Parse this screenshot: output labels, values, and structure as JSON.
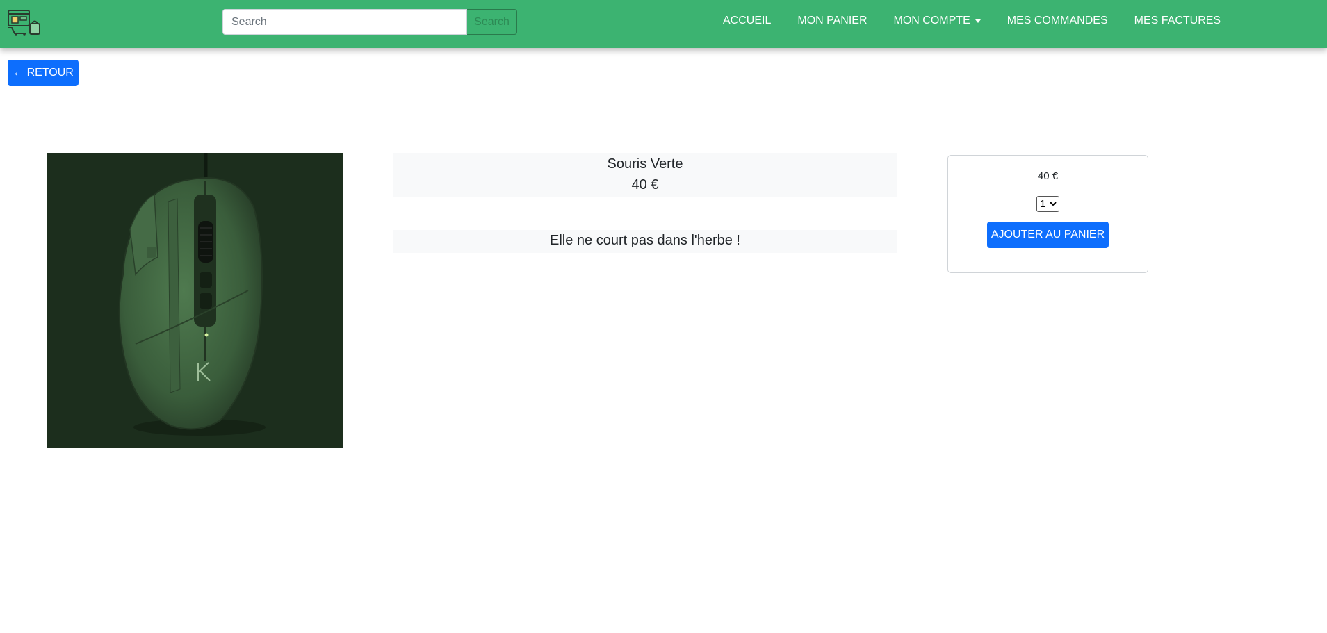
{
  "header": {
    "logo_icon": "shop-logo-icon",
    "search": {
      "placeholder": "Search",
      "value": "",
      "button_label": "Search"
    },
    "nav": [
      {
        "label": "ACCUEIL"
      },
      {
        "label": "MON PANIER"
      },
      {
        "label": "MON COMPTE"
      },
      {
        "label": "MES COMMANDES"
      },
      {
        "label": "MES FACTURES"
      }
    ]
  },
  "back_button": {
    "label": "← RETOUR"
  },
  "product": {
    "image_icon": "green-gaming-mouse",
    "name": "Souris Verte",
    "price": "40 €",
    "description": "Elle ne court pas dans l'herbe !"
  },
  "buy_card": {
    "price": "40 €",
    "quantity": "1",
    "add_label": "AJOUTER AU PANIER"
  },
  "colors": {
    "navbar": "#3cb371",
    "primary": "#0d6efd",
    "image_bg": "#1c2e1d"
  }
}
